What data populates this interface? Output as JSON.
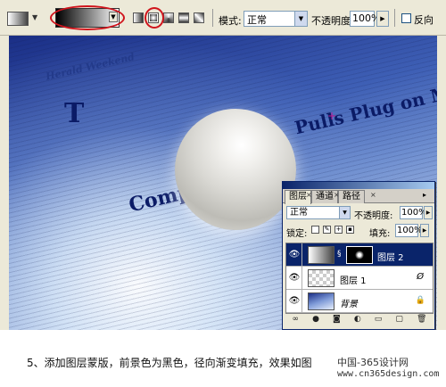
{
  "toolbar": {
    "mode_label": "模式:",
    "mode_value": "正常",
    "opacity_label": "不透明度:",
    "opacity_value": "100%",
    "reverse_label": "反向"
  },
  "photo": {
    "headline_right": "Pulls Plug on M",
    "headline_left": "Comp",
    "masthead": "Herald Weekend",
    "big_letter": "T"
  },
  "layers_panel": {
    "tabs": [
      "图层",
      "通道",
      "路径"
    ],
    "blend_mode": "正常",
    "opacity_label": "不透明度:",
    "opacity_value": "100%",
    "lock_label": "锁定:",
    "fill_label": "填充:",
    "fill_value": "100%",
    "layers": [
      {
        "name": "图层 2",
        "selected": true
      },
      {
        "name": "图层 1",
        "selected": false
      },
      {
        "name": "背景",
        "selected": false
      }
    ]
  },
  "caption": {
    "text": "5、添加图层蒙版，前景色为黑色，径向渐变填充，效果如图",
    "watermark_cn": "中国-365设计网",
    "watermark_url": "www.cn365design.com"
  },
  "colors": {
    "highlight_red": "#d0141c",
    "selection_blue": "#0a246a"
  }
}
